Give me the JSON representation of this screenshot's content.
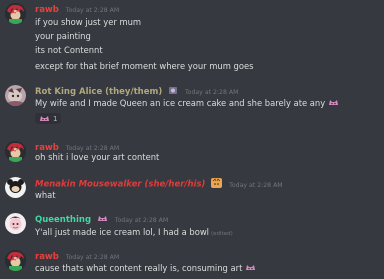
{
  "messages": [
    {
      "author": "rawb",
      "author_color": "#e7413d",
      "timestamp": "Today at 2:28 AM",
      "lines": [
        "if you show just yer mum",
        "your painting",
        "its not Contennt",
        "except for that brief moment where your mum goes"
      ]
    },
    {
      "author": "Rot King Alice (they/them)",
      "author_color": "#b0a97d",
      "timestamp": "Today at 2:28 AM",
      "lines": [
        "My wife and I made Queen an ice cream cake and she barely ate any"
      ],
      "reaction": {
        "emoji": "ice-cream-cat-emoji",
        "count": "1"
      }
    },
    {
      "author": "rawb",
      "author_color": "#e7413d",
      "timestamp": "Today at 2:28 AM",
      "lines": [
        "oh shit i love your art content"
      ]
    },
    {
      "author": "Menakin Mousewalker (she/her/his)",
      "author_color": "#e03c3c",
      "timestamp": "Today at 2:28 AM",
      "lines": [
        "what"
      ]
    },
    {
      "author": "Queenthing",
      "author_color": "#43d6a2",
      "timestamp": "Today at 2:28 AM",
      "lines": [
        "Y'all just made ice cream lol, I had a bowl"
      ],
      "edited": "(edited)"
    },
    {
      "author": "rawb",
      "author_color": "#e7413d",
      "timestamp": "Today at 2:28 AM",
      "lines": [
        "cause thats what content really is, consuming art"
      ]
    }
  ]
}
